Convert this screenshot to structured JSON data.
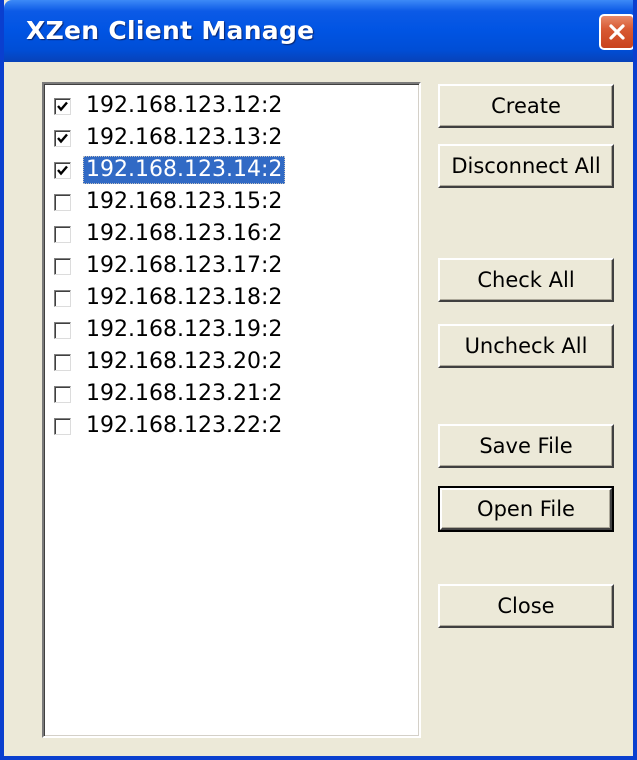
{
  "window": {
    "title": "XZen Client Manage"
  },
  "client_list": {
    "items": [
      {
        "label": "192.168.123.12:2",
        "checked": true,
        "selected": false
      },
      {
        "label": "192.168.123.13:2",
        "checked": true,
        "selected": false
      },
      {
        "label": "192.168.123.14:2",
        "checked": true,
        "selected": true
      },
      {
        "label": "192.168.123.15:2",
        "checked": false,
        "selected": false
      },
      {
        "label": "192.168.123.16:2",
        "checked": false,
        "selected": false
      },
      {
        "label": "192.168.123.17:2",
        "checked": false,
        "selected": false
      },
      {
        "label": "192.168.123.18:2",
        "checked": false,
        "selected": false
      },
      {
        "label": "192.168.123.19:2",
        "checked": false,
        "selected": false
      },
      {
        "label": "192.168.123.20:2",
        "checked": false,
        "selected": false
      },
      {
        "label": "192.168.123.21:2",
        "checked": false,
        "selected": false
      },
      {
        "label": "192.168.123.22:2",
        "checked": false,
        "selected": false
      }
    ]
  },
  "buttons": {
    "create": "Create",
    "disconnect_all": "Disconnect All",
    "check_all": "Check All",
    "uncheck_all": "Uncheck All",
    "save_file": "Save File",
    "open_file": "Open File",
    "close": "Close"
  },
  "icons": {
    "close": "close-icon",
    "check": "checkmark-icon"
  },
  "colors": {
    "titlebar": "#0054e3",
    "selection": "#316ac5",
    "close_button": "#d85a34",
    "dialog_background": "#ece9d8"
  }
}
